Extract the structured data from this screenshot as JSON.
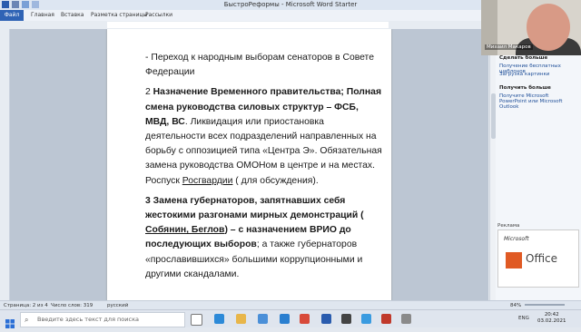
{
  "window": {
    "title": "БыстроРеформы  -  Microsoft Word Starter"
  },
  "ribbon": {
    "file_label": "Файл",
    "tabs": [
      "Главная",
      "Вставка",
      "Разметка страницы",
      "Рассылки"
    ]
  },
  "document": {
    "paragraphs": [
      {
        "plain": "- Переход к народным выборам сенаторов в Совете Федерации"
      },
      {
        "num": "2 ",
        "bold1": "Назначение Временного правительства;",
        "bold2": "Полная смена руководства силовых структур – ФСБ, МВД, ВС",
        "rest": ".  Ликвидация или приостановка деятельности всех подразделений направленных на борьбу с оппозицией типа «Центра Э». Обязательная замена руководства ОМОНом в центре и на местах.  Роспуск ",
        "underlined": "Росгвардии",
        "tail": " ( для обсуждения)."
      },
      {
        "bold_a": "3 Замена губернаторов, запятнавших себя жестокими разгонами мирных демонстраций ( ",
        "bold_u": "Собянин, Беглов",
        "bold_b": ") – с назначением ВРИО до последующих выборов",
        "tail": ";  а также губернаторов «прославившихся» большими коррупционными и другими скандалами."
      }
    ]
  },
  "webcam": {
    "name": "Михаил Макаров"
  },
  "right_panel": {
    "heading1": "Сделать больше",
    "link1": "Получение бесплатных шаблонов",
    "link2": "Загрузка картинки",
    "heading2": "Получить больше",
    "link3": "Получите Microsoft PowerPoint или Microsoft Outlook",
    "ad_label": "Реклама",
    "ad_brand": "Microsoft",
    "ad_product": "Office"
  },
  "statusbar": {
    "page": "Страница: 2 из 4",
    "words": "Число слов: 319",
    "language": "русский",
    "zoom": "84%"
  },
  "taskbar": {
    "search_placeholder": "Введите здесь текст для поиска",
    "lang": "ENG",
    "time": "20:42",
    "date": "03.02.2021"
  },
  "colors": {
    "ribbon_file": "#2f63b5",
    "link": "#1e4e98"
  }
}
